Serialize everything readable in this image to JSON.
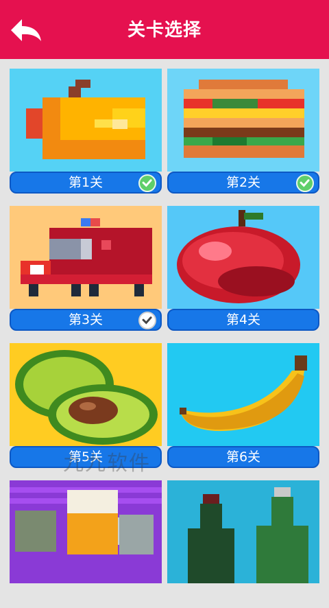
{
  "header": {
    "title": "关卡选择",
    "back_icon": "back-arrow-icon",
    "bg": "#e5114f"
  },
  "levels": [
    {
      "label": "第1关",
      "status": "completed",
      "picture": "orange-fruit"
    },
    {
      "label": "第2关",
      "status": "completed",
      "picture": "hamburger"
    },
    {
      "label": "第3关",
      "status": "checked",
      "picture": "fire-truck"
    },
    {
      "label": "第4关",
      "status": "none",
      "picture": "apple"
    },
    {
      "label": "第5关",
      "status": "none",
      "picture": "avocado"
    },
    {
      "label": "第6关",
      "status": "none",
      "picture": "banana"
    },
    {
      "label": "",
      "status": "none",
      "picture": "beer-mugs"
    },
    {
      "label": "",
      "status": "none",
      "picture": "wine-bottles"
    }
  ],
  "watermark": "九九软件",
  "colors": {
    "pill": "#1777e8",
    "check_green": "#5fcf6a"
  }
}
